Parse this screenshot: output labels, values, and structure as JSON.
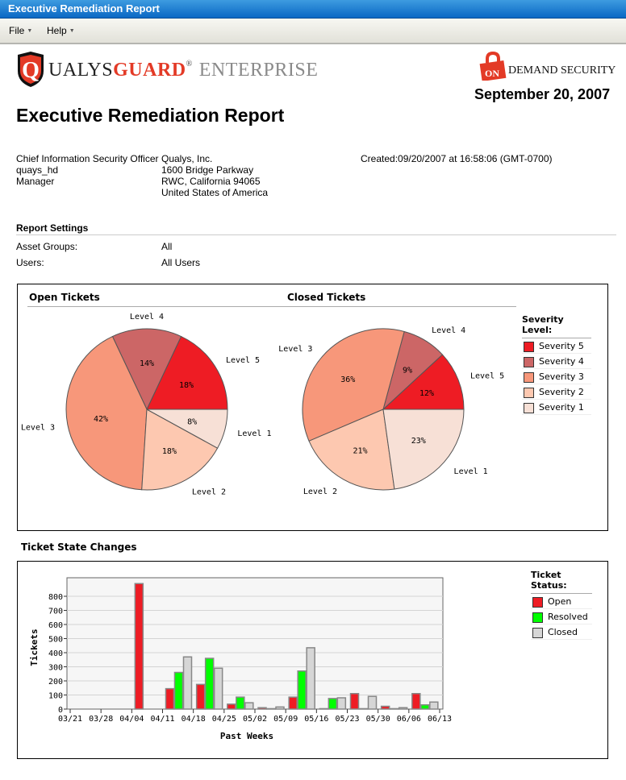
{
  "window": {
    "title": "Executive Remediation Report"
  },
  "menu": [
    {
      "label": "File"
    },
    {
      "label": "Help"
    }
  ],
  "branding": {
    "logo_q": "Q",
    "logo_ualys": "UALYS",
    "logo_guard": "GUARD",
    "logo_reg": "®",
    "logo_enterprise": "ENTERPRISE",
    "ods_on": "ON",
    "ods_text": "DEMAND SECURITY",
    "colors": {
      "brand_red": "#e33a26",
      "titlebar": "#0a68c4"
    }
  },
  "report": {
    "date": "September 20, 2007",
    "title": "Executive Remediation Report",
    "user_lines": [
      "Chief Information Security Officer",
      "quays_hd",
      "Manager"
    ],
    "company_lines": [
      "Qualys, Inc.",
      "1600 Bridge Parkway",
      "RWC, California 94065",
      "United States of America"
    ],
    "created": "Created:09/20/2007 at 16:58:06 (GMT-0700)"
  },
  "settings": {
    "heading": "Report Settings",
    "rows": [
      {
        "label": "Asset Groups:",
        "value": "All"
      },
      {
        "label": "Users:",
        "value": "All Users"
      }
    ]
  },
  "severity_legend": {
    "title": "Severity Level:",
    "items": [
      {
        "label": "Severity 5",
        "color": "#ee1c24"
      },
      {
        "label": "Severity 4",
        "color": "#cc6666"
      },
      {
        "label": "Severity 3",
        "color": "#f7977a"
      },
      {
        "label": "Severity 2",
        "color": "#fdc8b0"
      },
      {
        "label": "Severity 1",
        "color": "#f7e0d6"
      }
    ]
  },
  "ticket_legend": {
    "title": "Ticket Status:",
    "items": [
      {
        "label": "Open",
        "color": "#ee1c24"
      },
      {
        "label": "Resolved",
        "color": "#00ff00"
      },
      {
        "label": "Closed",
        "color": "#d6d6d6"
      }
    ]
  },
  "state_changes_heading": "Ticket State Changes",
  "chart_data": [
    {
      "type": "pie",
      "title": "Open Tickets",
      "slices": [
        {
          "label": "Level 5",
          "value": 18,
          "display": "18%",
          "color": "#ee1c24"
        },
        {
          "label": "Level 4",
          "value": 14,
          "display": "14%",
          "color": "#cc6666"
        },
        {
          "label": "Level 3",
          "value": 42,
          "display": "42%",
          "color": "#f7977a"
        },
        {
          "label": "Level 2",
          "value": 18,
          "display": "18%",
          "color": "#fdc8b0"
        },
        {
          "label": "Level 1",
          "value": 8,
          "display": "8%",
          "color": "#f7e0d6"
        }
      ]
    },
    {
      "type": "pie",
      "title": "Closed Tickets",
      "slices": [
        {
          "label": "Level 5",
          "value": 12,
          "display": "12%",
          "color": "#ee1c24"
        },
        {
          "label": "Level 4",
          "value": 9,
          "display": "9%",
          "color": "#cc6666"
        },
        {
          "label": "Level 3",
          "value": 36,
          "display": "36%",
          "color": "#f7977a"
        },
        {
          "label": "Level 2",
          "value": 21,
          "display": "21%",
          "color": "#fdc8b0"
        },
        {
          "label": "Level 1",
          "value": 23,
          "display": "23%",
          "color": "#f7e0d6"
        }
      ]
    },
    {
      "type": "bar",
      "title": "Ticket State Changes",
      "xlabel": "Past Weeks",
      "ylabel": "Tickets",
      "ylim": [
        0,
        900
      ],
      "yticks": [
        0,
        100,
        200,
        300,
        400,
        500,
        600,
        700,
        800
      ],
      "grid": true,
      "legend": "right",
      "categories": [
        "03/21",
        "03/28",
        "04/04",
        "04/11",
        "04/18",
        "04/25",
        "05/02",
        "05/09",
        "05/16",
        "05/23",
        "05/30",
        "06/06",
        "06/13"
      ],
      "series": [
        {
          "name": "Open",
          "color": "#ee1c24",
          "values": [
            0,
            0,
            890,
            145,
            175,
            35,
            10,
            85,
            3,
            110,
            20,
            110
          ]
        },
        {
          "name": "Resolved",
          "color": "#00ff00",
          "values": [
            0,
            0,
            0,
            260,
            360,
            85,
            3,
            270,
            75,
            3,
            3,
            30
          ]
        },
        {
          "name": "Closed",
          "color": "#d6d6d6",
          "values": [
            0,
            0,
            0,
            370,
            290,
            45,
            15,
            435,
            80,
            90,
            10,
            50
          ]
        }
      ]
    }
  ]
}
